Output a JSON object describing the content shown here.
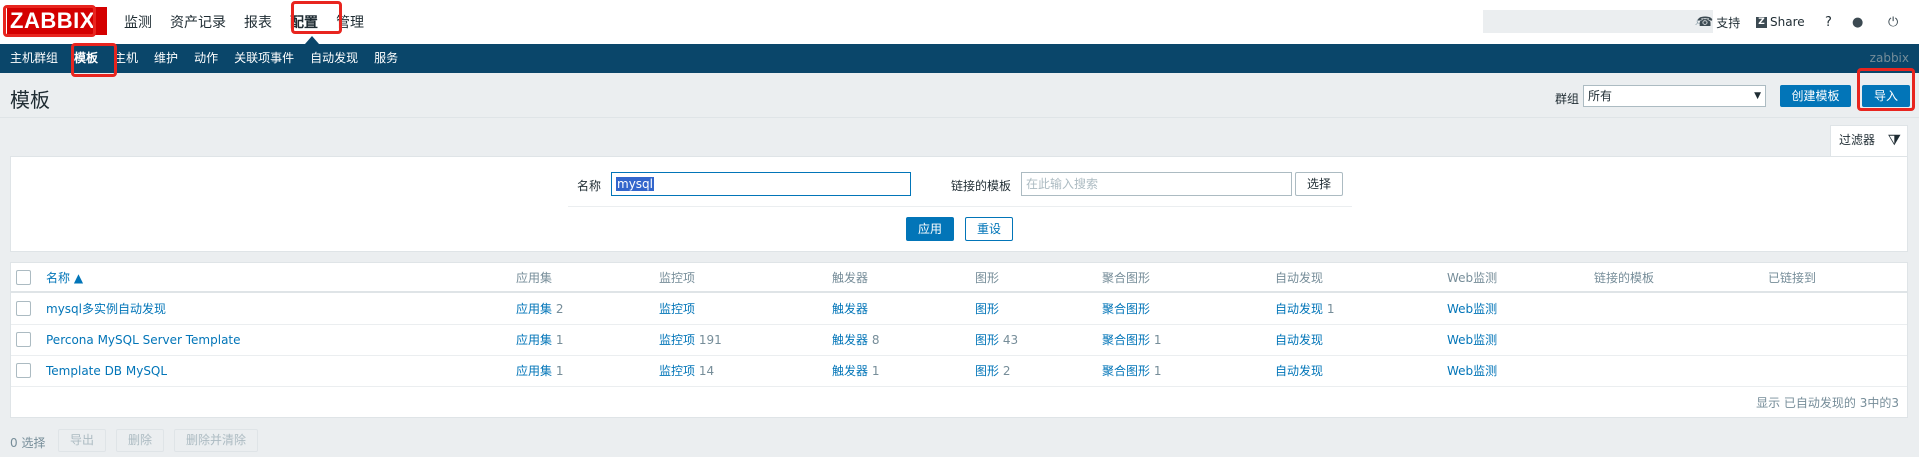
{
  "header": {
    "logo": "ZABBIX",
    "menu": [
      "监测",
      "资产记录",
      "报表",
      "配置",
      "管理"
    ],
    "active_menu": "配置",
    "search_placeholder": "",
    "support_label": "支持",
    "share_label": "Share",
    "help_label": "?",
    "icons": {
      "search": "search-icon",
      "support": "headset-icon",
      "share": "share-icon",
      "user": "user-icon",
      "logout": "power-icon"
    }
  },
  "subnav": {
    "items": [
      "主机群组",
      "模板",
      "主机",
      "维护",
      "动作",
      "关联项事件",
      "自动发现",
      "服务"
    ],
    "active": "模板",
    "server_name": "zabbix"
  },
  "page": {
    "title": "模板",
    "group_label": "群组",
    "group_value": "所有",
    "create_button": "创建模板",
    "import_button": "导入"
  },
  "filter": {
    "tab_label": "过滤器",
    "name_label": "名称",
    "name_value": "mysql",
    "linked_label": "链接的模板",
    "linked_placeholder": "在此输入搜索",
    "select_button": "选择",
    "apply_button": "应用",
    "reset_button": "重设"
  },
  "table": {
    "columns": [
      "名称 ▲",
      "应用集",
      "监控项",
      "触发器",
      "图形",
      "聚合图形",
      "自动发现",
      "Web监测",
      "链接的模板",
      "已链接到"
    ],
    "rows": [
      {
        "name": "mysql多实例自动发现",
        "apps": "应用集",
        "apps_count": "2",
        "items": "监控项",
        "items_count": "",
        "triggers": "触发器",
        "triggers_count": "",
        "graphs": "图形",
        "graphs_count": "",
        "screens": "聚合图形",
        "screens_count": "",
        "discovery": "自动发现",
        "discovery_count": "1",
        "web": "Web监测"
      },
      {
        "name": "Percona MySQL Server Template",
        "apps": "应用集",
        "apps_count": "1",
        "items": "监控项",
        "items_count": "191",
        "triggers": "触发器",
        "triggers_count": "8",
        "graphs": "图形",
        "graphs_count": "43",
        "screens": "聚合图形",
        "screens_count": "1",
        "discovery": "自动发现",
        "discovery_count": "",
        "web": "Web监测"
      },
      {
        "name": "Template DB MySQL",
        "apps": "应用集",
        "apps_count": "1",
        "items": "监控项",
        "items_count": "14",
        "triggers": "触发器",
        "triggers_count": "1",
        "graphs": "图形",
        "graphs_count": "2",
        "screens": "聚合图形",
        "screens_count": "1",
        "discovery": "自动发现",
        "discovery_count": "",
        "web": "Web监测"
      }
    ],
    "footer": "显示 已自动发现的 3中的3"
  },
  "actions": {
    "selected": "0 选择",
    "export": "导出",
    "delete": "删除",
    "delete_clear": "删除并清除"
  },
  "colors": {
    "accent": "#0275b8",
    "nav": "#0a466a",
    "logo": "#d40000",
    "highlight_box": "#e8251f"
  }
}
